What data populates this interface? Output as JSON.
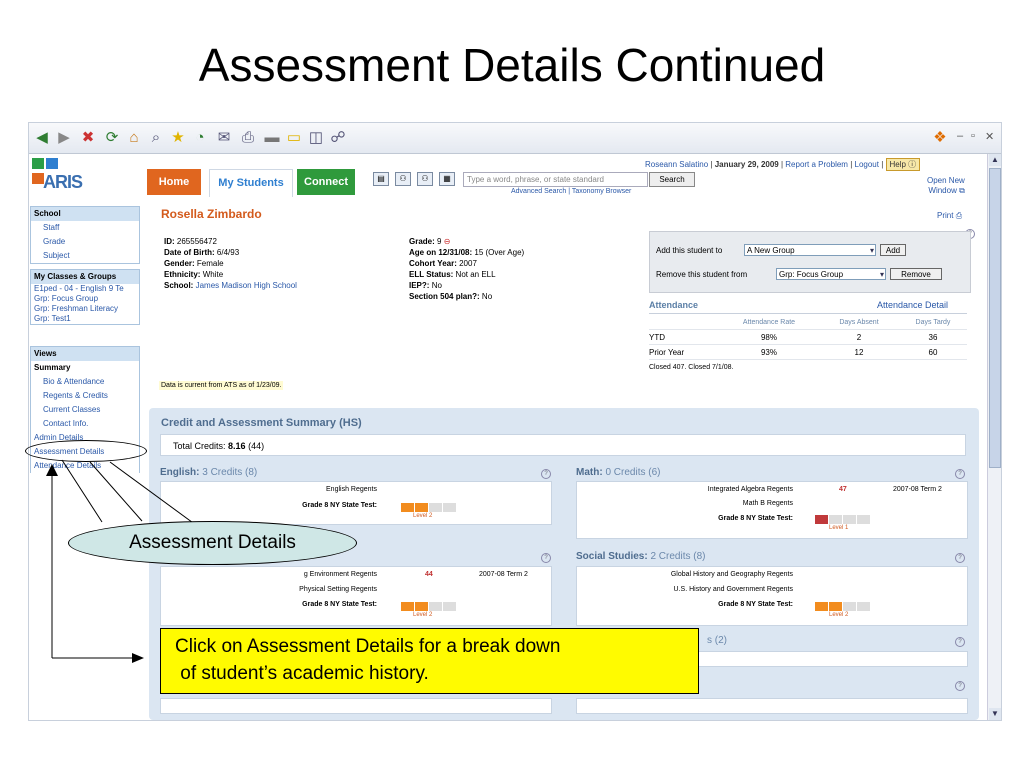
{
  "slide": {
    "title": "Assessment Details Continued"
  },
  "header": {
    "app_name": "ARIS",
    "tabs": [
      {
        "label": "Home"
      },
      {
        "label": "My Students"
      },
      {
        "label": "Connect"
      }
    ],
    "search_placeholder": "Type a word, phrase, or state standard",
    "search_button": "Search",
    "advanced_search": "Advanced Search",
    "taxonomy_browser": "Taxonomy Browser",
    "user_name": "Roseann Salatino",
    "date": "January 29, 2009",
    "report_problem": "Report a Problem",
    "logout": "Logout",
    "help": "Help",
    "open_new_1": "Open New",
    "open_new_2": "Window"
  },
  "sidebar": {
    "school_head": "School",
    "school_items": [
      "Staff",
      "Grade",
      "Subject"
    ],
    "classes_head": "My Classes & Groups",
    "classes_items": [
      "E1ped - 04 - English 9 Te",
      "Grp: Focus Group",
      "Grp: Freshman Literacy",
      "Grp: Test1"
    ],
    "views_head": "Views",
    "summary_label": "Summary",
    "views_items": [
      "Bio & Attendance",
      "Regents & Credits",
      "Current Classes",
      "Contact Info.",
      "Admin Details",
      "Assessment Details",
      "Attendance Details"
    ]
  },
  "student": {
    "name": "Rosella Zimbardo",
    "print": "Print",
    "id_label": "ID:",
    "id": "265556472",
    "dob_label": "Date of Birth:",
    "dob": "6/4/93",
    "gender_label": "Gender:",
    "gender": "Female",
    "ethnicity_label": "Ethnicity:",
    "ethnicity": "White",
    "school_label": "School:",
    "school": "James Madison High School",
    "grade_label": "Grade:",
    "grade": "9",
    "age_label": "Age on 12/31/08:",
    "age": "15 (Over Age)",
    "cohort_label": "Cohort Year:",
    "cohort": "2007",
    "ell_label": "ELL Status:",
    "ell": "Not an ELL",
    "iep_label": "IEP?:",
    "iep": "No",
    "sec504_label": "Section 504 plan?:",
    "sec504": "No",
    "data_note": "Data is current from ATS as of 1/23/09."
  },
  "groups": {
    "add_label": "Add this student to",
    "add_select": "A New Group",
    "add_button": "Add",
    "remove_label": "Remove this student from",
    "remove_select": "Grp: Focus Group",
    "remove_button": "Remove"
  },
  "attendance": {
    "title": "Attendance",
    "detail_link": "Attendance Detail",
    "columns": [
      "Attendance Rate",
      "Days Absent",
      "Days Tardy"
    ],
    "rows": [
      {
        "label": "YTD",
        "rate": "98%",
        "absent": "2",
        "tardy": "36"
      },
      {
        "label": "Prior Year",
        "rate": "93%",
        "absent": "12",
        "tardy": "60"
      }
    ],
    "closed_note": "Closed 407. Closed 7/1/08."
  },
  "summary": {
    "title": "Credit and Assessment Summary (HS)",
    "total_label": "Total Credits:",
    "total_value": "8.16",
    "total_paren": "(44)"
  },
  "subjects": {
    "english": {
      "name": "English:",
      "credits": "3 Credits (8)",
      "rows": [
        {
          "exam": "English Regents"
        },
        {
          "exam": "Grade 8 NY State Test:",
          "level": "Level 2"
        }
      ]
    },
    "math": {
      "name": "Math:",
      "credits": "0 Credits (6)",
      "rows": [
        {
          "exam": "Integrated Algebra Regents",
          "score": "47",
          "term": "2007-08 Term 2"
        },
        {
          "exam": "Math B Regents"
        },
        {
          "exam": "Grade 8 NY State Test:",
          "level": "Level 1"
        }
      ]
    },
    "science": {
      "rows": [
        {
          "exam": "g Environment Regents",
          "score": "44",
          "term": "2007-08 Term 2"
        },
        {
          "exam": "Physical Setting Regents"
        },
        {
          "exam": "Grade 8 NY State Test:",
          "level": "Level 2"
        }
      ]
    },
    "social": {
      "name": "Social Studies:",
      "credits": "2 Credits (8)",
      "rows": [
        {
          "exam": "Global History and Geography Regents"
        },
        {
          "exam": "U.S. History and Government Regents"
        },
        {
          "exam": "Grade 8 NY State Test:",
          "level": "Level 2"
        }
      ]
    },
    "partial_credits": "s (2)"
  },
  "annotations": {
    "callout": "Assessment Details",
    "note_line1": "Click on Assessment Details for a break down",
    "note_line2": " of student’s academic history."
  },
  "colors": {
    "home_tab": "#e0661f",
    "connect_tab": "#2f9a3c",
    "level_orange": "#f28c1e",
    "level_red": "#c0393b",
    "note_yellow": "#fffb00",
    "callout_fill": "#cfe7e6"
  }
}
